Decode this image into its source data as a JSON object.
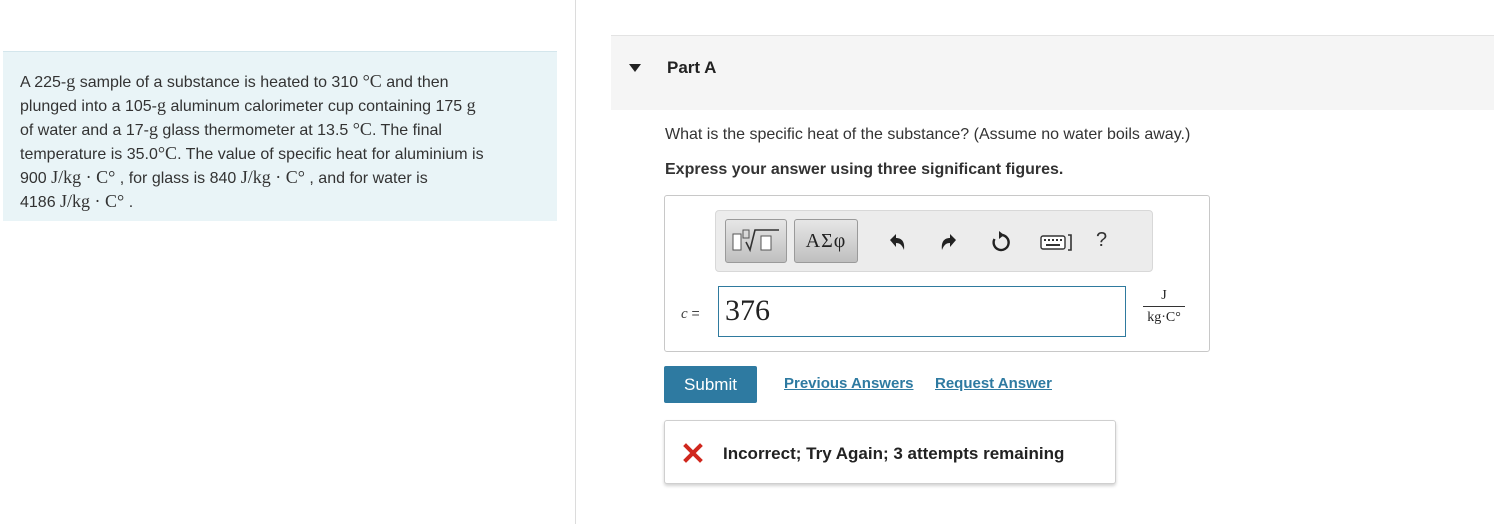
{
  "problem": {
    "line1_a": "A 225-",
    "line1_g": "g",
    "line1_b": " sample of a substance is heated to 310 ",
    "line1_deg": "°C",
    "line1_c": " and then",
    "line2_a": "plunged into a 105-",
    "line2_g": "g",
    "line2_b": " aluminum calorimeter cup containing 175 ",
    "line2_g2": "g",
    "line3_a": "of water and a 17-",
    "line3_g": "g",
    "line3_b": " glass thermometer at 13.5 ",
    "line3_deg": "°C",
    "line3_c": ". The final",
    "line4_a": "temperature is 35.0",
    "line4_deg": "°C",
    "line4_b": ". The value of specific heat for aluminium is",
    "line5_a": "900 ",
    "line5_unit": "J/kg · C°",
    "line5_b": " , for glass is 840 ",
    "line5_unit2": "J/kg · C°",
    "line5_c": " , and for water is",
    "line6_a": "4186 ",
    "line6_unit": "J/kg · C°",
    "line6_b": " ."
  },
  "part": {
    "title": "Part A"
  },
  "question": "What is the specific heat of the substance? (Assume no water boils away.)",
  "instruction": "Express your answer using three significant figures.",
  "toolbar": {
    "symbols_label": "ΑΣφ",
    "help_label": "?"
  },
  "answer": {
    "variable": "c",
    "equals": " =",
    "value": "376",
    "unit_num": "J",
    "unit_den": "kg·C°"
  },
  "actions": {
    "submit": "Submit",
    "previous_answers": "Previous Answers",
    "request_answer": "Request Answer"
  },
  "feedback": {
    "text": "Incorrect; Try Again; 3 attempts remaining",
    "icon_color": "#d0271d"
  },
  "colors": {
    "accent": "#2e7aa1",
    "problem_bg": "#e9f4f7"
  }
}
